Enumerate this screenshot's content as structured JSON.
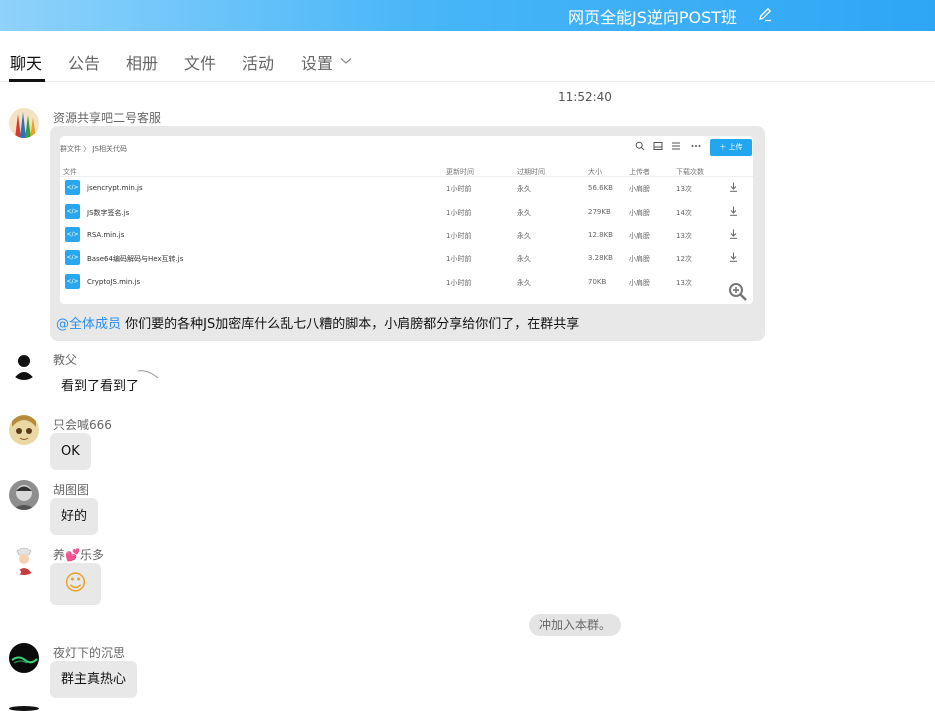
{
  "titlebar": {
    "title": "网页全能JS逆向POST班"
  },
  "tabs": [
    {
      "label": "聊天",
      "active": true
    },
    {
      "label": "公告"
    },
    {
      "label": "相册"
    },
    {
      "label": "文件"
    },
    {
      "label": "活动"
    },
    {
      "label": "设置"
    }
  ],
  "chat": {
    "timestamp": "11:52:40",
    "messages": [
      {
        "sender": "资源共享吧二号客服",
        "image": {
          "breadcrumb": "群文件 〉 JS相关代码",
          "upload_label": "上传",
          "columns": [
            "文件",
            "更新时间",
            "过期时间",
            "大小",
            "上传者",
            "下载次数"
          ],
          "rows": [
            {
              "name": "jsencrypt.min.js",
              "updated": "1小时前",
              "expires": "永久",
              "size": "56.6KB",
              "uploader": "小肩膀",
              "downloads": "13次"
            },
            {
              "name": "JS数字签名.js",
              "updated": "1小时前",
              "expires": "永久",
              "size": "279KB",
              "uploader": "小肩膀",
              "downloads": "14次"
            },
            {
              "name": "RSA.min.js",
              "updated": "1小时前",
              "expires": "永久",
              "size": "12.8KB",
              "uploader": "小肩膀",
              "downloads": "13次"
            },
            {
              "name": "Base64编码解码与Hex互转.js",
              "updated": "1小时前",
              "expires": "永久",
              "size": "3.28KB",
              "uploader": "小肩膀",
              "downloads": "12次"
            },
            {
              "name": "CryptoJS.min.js",
              "updated": "1小时前",
              "expires": "永久",
              "size": "70KB",
              "uploader": "小肩膀",
              "downloads": "13次"
            }
          ]
        },
        "mention": "@全体成员",
        "text": "你们要的各种JS加密库什么乱七八糟的脚本，小肩膀都分享给你们了，在群共享"
      },
      {
        "sender": "教父",
        "text": "看到了看到了"
      },
      {
        "sender": "只会喊666",
        "text": "OK"
      },
      {
        "sender": "胡图图",
        "text": "好的"
      },
      {
        "sender": "养💕乐多",
        "emoji": "☺"
      },
      {
        "sender": "夜灯下的沉思",
        "text": "群主真热心"
      }
    ],
    "system_notice": "冲加入本群。"
  },
  "colors": {
    "accent": "#2fa6f4",
    "mention": "#2a8ef2",
    "bubble": "#e8e8e8"
  }
}
